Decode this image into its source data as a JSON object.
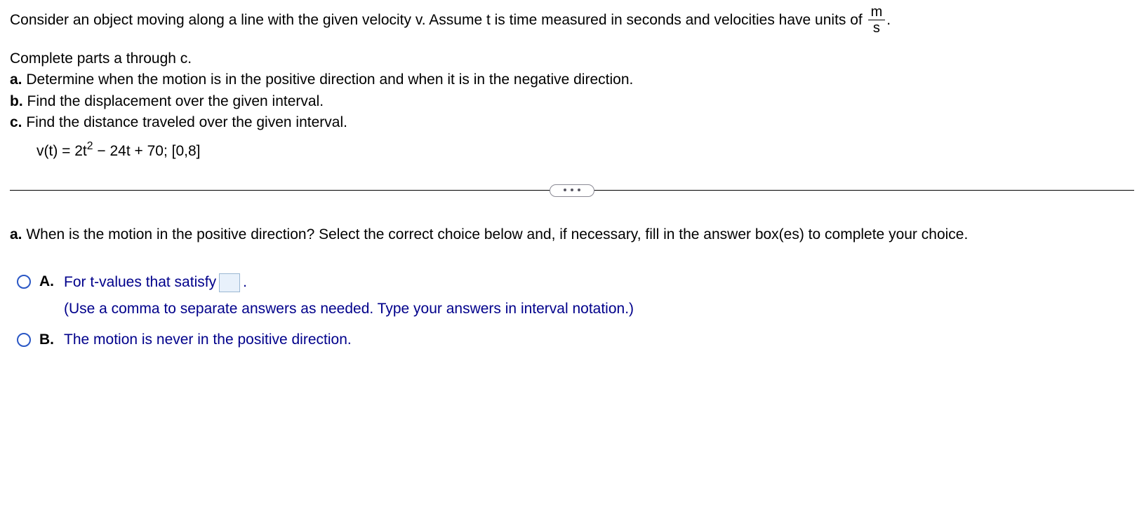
{
  "intro": {
    "text_before_frac": "Consider an object moving along a line with the given velocity v. Assume t is time measured in seconds and velocities have units of ",
    "frac_num": "m",
    "frac_den": "s",
    "text_after_frac": "."
  },
  "parts": {
    "lead": "Complete parts a through c.",
    "a_label": "a.",
    "a_text": "Determine when the motion is in the positive direction and when it is in the negative direction.",
    "b_label": "b.",
    "b_text": "Find the displacement over the given interval.",
    "c_label": "c.",
    "c_text": "Find the distance traveled over the given interval."
  },
  "equation": {
    "prefix": "v(t) = 2t",
    "exp": "2",
    "suffix": " − 24t + 70; [0,8]"
  },
  "question": {
    "label": "a.",
    "text": "When is the motion in the positive direction? Select the correct choice below and, if necessary, fill in the answer box(es) to complete your choice."
  },
  "choices": {
    "a": {
      "label": "A.",
      "line_before_box": "For t-values that satisfy",
      "line_after_box": ".",
      "hint": "(Use a comma to separate answers as needed. Type your answers in interval notation.)"
    },
    "b": {
      "label": "B.",
      "text": "The motion is never in the positive direction."
    }
  }
}
